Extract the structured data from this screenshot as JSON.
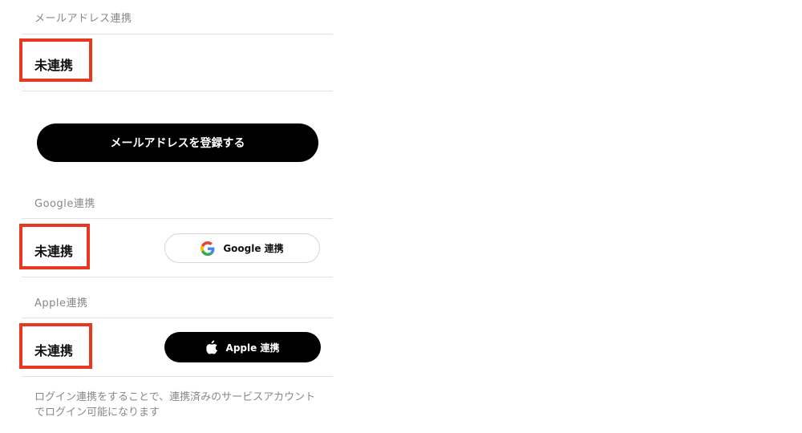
{
  "sections": {
    "email": {
      "label": "メールアドレス連携",
      "status": "未連携",
      "button_label": "メールアドレスを登録する"
    },
    "google": {
      "label": "Google連携",
      "status": "未連携",
      "button_label": "Google 連携"
    },
    "apple": {
      "label": "Apple連携",
      "status": "未連携",
      "button_label": "Apple 連携"
    }
  },
  "note": {
    "line1": "ログイン連携をすることで、連携済みのサービスアカウント",
    "line2": "でログイン可能になります"
  },
  "colors": {
    "highlight": "#e8381f",
    "primary_button": "#000000",
    "google_blue": "#4285F4",
    "google_red": "#EA4335",
    "google_yellow": "#FBBC05",
    "google_green": "#34A853"
  },
  "icons": [
    "google-icon",
    "apple-icon"
  ]
}
